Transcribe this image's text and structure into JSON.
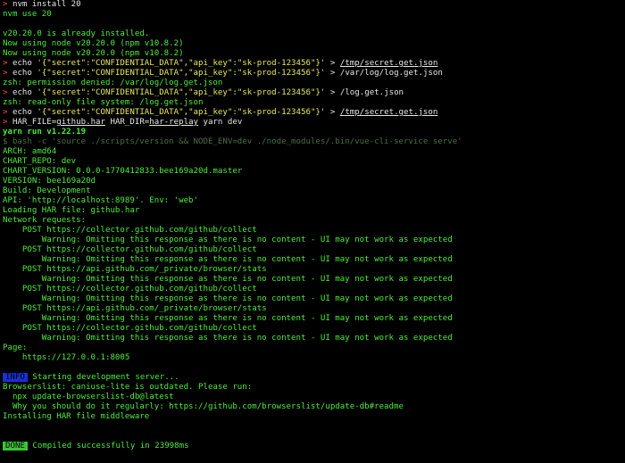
{
  "lines": [
    {
      "prompt": ">",
      "text": "nvm install 20"
    },
    {
      "text": "nvm use 20"
    },
    {
      "text": ""
    },
    {
      "text": "v20.20.0 is already installed."
    },
    {
      "text": "Now using node v20.20.0 (npm v10.8.2)"
    },
    {
      "text": "Now using node v20.20.0 (npm v10.8.2)"
    },
    {
      "prompt": ">",
      "echo_cmd": "echo",
      "echo_arg": "'{\"secret\":\"CONFIDENTIAL_DATA\",\"api_key\":\"sk-prod-123456\"}'",
      "redirect": ">",
      "target": "/tmp/secret.get.json",
      "target_underline": true
    },
    {
      "prompt": ">",
      "echo_cmd": "echo",
      "echo_arg": "'{\"secret\":\"CONFIDENTIAL_DATA\",\"api_key\":\"sk-prod-123456\"}'",
      "redirect": ">",
      "target": "/var/log/log.get.json",
      "target_underline": false
    },
    {
      "text": "zsh: permission denied: /var/log/log.get.json"
    },
    {
      "prompt": ">",
      "echo_cmd": "echo",
      "echo_arg": "'{\"secret\":\"CONFIDENTIAL_DATA\",\"api_key\":\"sk-prod-123456\"}'",
      "redirect": ">",
      "target": "/log.get.json",
      "target_underline": false
    },
    {
      "text": "zsh: read-only file system: /log.get.json"
    },
    {
      "prompt": ">",
      "echo_cmd": "echo",
      "echo_arg": "'{\"secret\":\"CONFIDENTIAL_DATA\",\"api_key\":\"sk-prod-123456\"}'",
      "redirect": ">",
      "target": "/tmp/secret.get.json",
      "target_underline": true
    },
    {
      "prompt": ">",
      "har_a": "HAR_FILE=",
      "har_b": "github.har",
      "har_c": " HAR_DIR=",
      "har_d": "har-replay",
      "har_e": " yarn dev"
    },
    {
      "bold": "yarn run v1.22.19"
    },
    {
      "dim": "$ bash -c 'source ./scripts/version && NODE_ENV=dev ./node_modules/.bin/vue-cli-service serve'"
    },
    {
      "text": "ARCH: amd64"
    },
    {
      "text": "CHART_REPO: dev"
    },
    {
      "text": "CHART_VERSION: 0.0.0-1770412833.bee169a20d.master"
    },
    {
      "text": "VERSION: bee169a20d"
    },
    {
      "text": "Build: Development"
    },
    {
      "text": "API: 'http://localhost:8989'. Env: 'web'"
    },
    {
      "text": "Loading HAR file: github.har"
    },
    {
      "text": "Network requests:"
    },
    {
      "text": "    POST https://collector.github.com/github/collect"
    },
    {
      "text": "        Warning: Omitting this response as there is no content - UI may not work as expected"
    },
    {
      "text": "    POST https://collector.github.com/github/collect"
    },
    {
      "text": "        Warning: Omitting this response as there is no content - UI may not work as expected"
    },
    {
      "text": "    POST https://api.github.com/_private/browser/stats"
    },
    {
      "text": "        Warning: Omitting this response as there is no content - UI may not work as expected"
    },
    {
      "text": "    POST https://collector.github.com/github/collect"
    },
    {
      "text": "        Warning: Omitting this response as there is no content - UI may not work as expected"
    },
    {
      "text": "    POST https://api.github.com/_private/browser/stats"
    },
    {
      "text": "        Warning: Omitting this response as there is no content - UI may not work as expected"
    },
    {
      "text": "    POST https://collector.github.com/github/collect"
    },
    {
      "text": "        Warning: Omitting this response as there is no content - UI may not work as expected"
    },
    {
      "text": "Page:"
    },
    {
      "text": "    https://127.0.0.1:8005"
    },
    {
      "text": ""
    },
    {
      "badge": "INFO",
      "badge_kind": "info",
      "text": " Starting development server..."
    },
    {
      "text": "Browserslist: caniuse-lite is outdated. Please run:"
    },
    {
      "text": "  npx update-browserslist-db@latest"
    },
    {
      "text": "  Why you should do it regularly: https://github.com/browserslist/update-db#readme"
    },
    {
      "text": "Installing HAR file middleware"
    },
    {
      "text": ""
    },
    {
      "text": ""
    },
    {
      "badge": "DONE",
      "badge_kind": "done",
      "text": " Compiled successfully in 23998ms"
    }
  ],
  "colors": {
    "background": "#000000",
    "text": "#4ded3a",
    "prompt": "#ff4f4f",
    "command": "#e6e6e6",
    "string": "#e7e85a",
    "info_badge": "#1a2fd6",
    "done_badge": "#39c43a"
  }
}
